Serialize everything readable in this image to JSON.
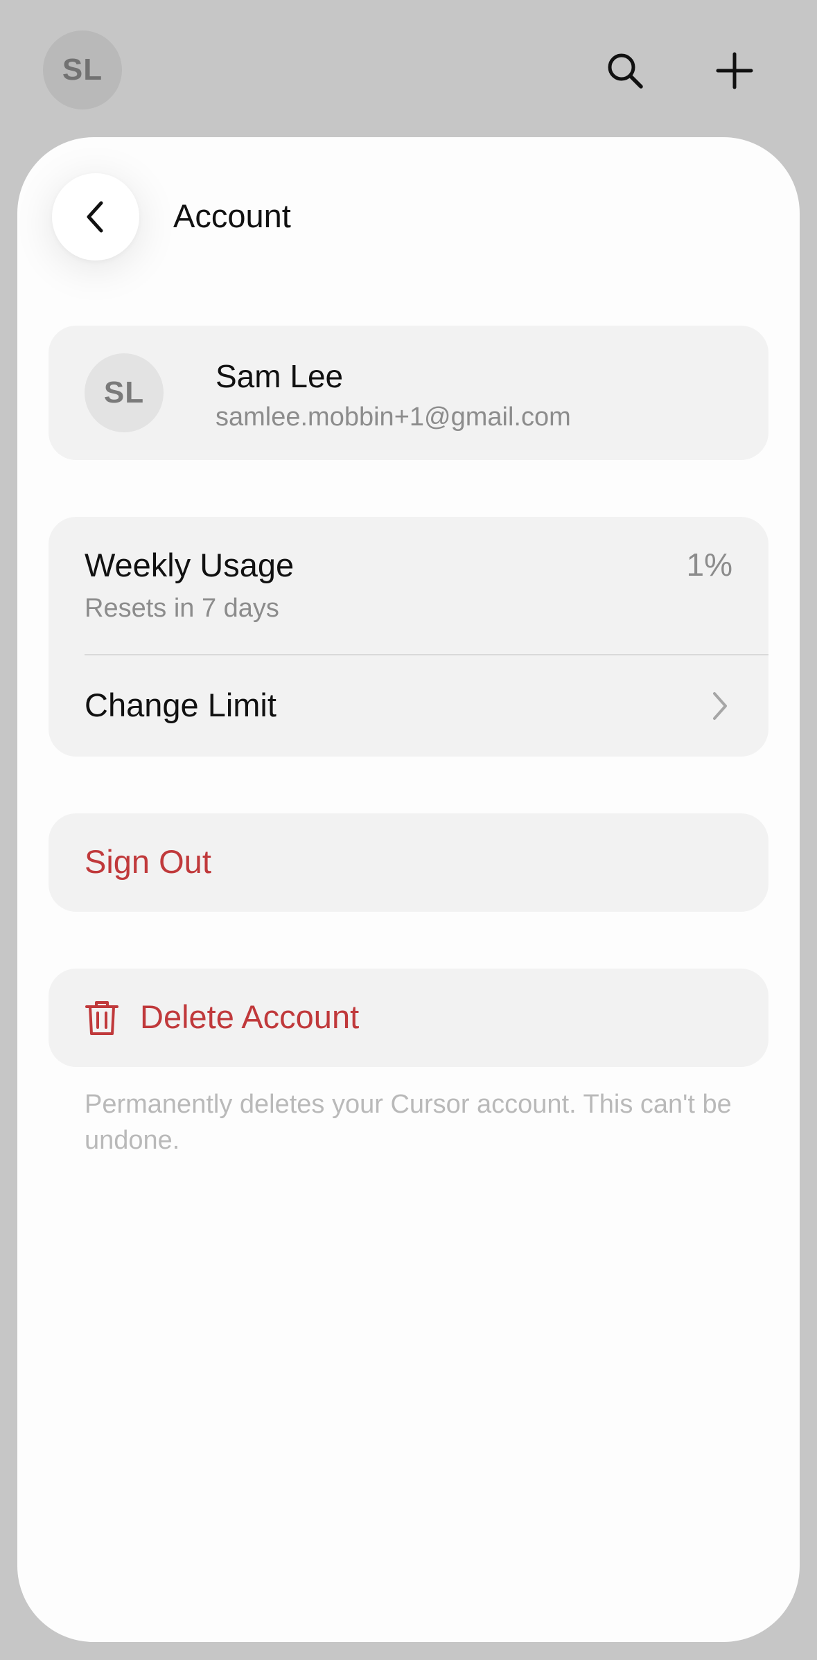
{
  "topbar": {
    "avatar_initials": "SL",
    "search_icon": "search-icon",
    "add_icon": "plus-icon"
  },
  "sheet": {
    "title": "Account",
    "back_icon": "chevron-left-icon"
  },
  "profile": {
    "initials": "SL",
    "name": "Sam Lee",
    "email": "samlee.mobbin+1@gmail.com"
  },
  "usage": {
    "label": "Weekly Usage",
    "reset_text": "Resets in 7 days",
    "value": "1%",
    "change_limit_label": "Change Limit"
  },
  "actions": {
    "sign_out_label": "Sign Out",
    "delete_account_label": "Delete Account",
    "delete_note": "Permanently deletes your Cursor account. This can't be undone."
  },
  "colors": {
    "destructive": "#c0393b",
    "card_background": "#f2f2f2",
    "overlay_background": "#c6c6c6"
  }
}
